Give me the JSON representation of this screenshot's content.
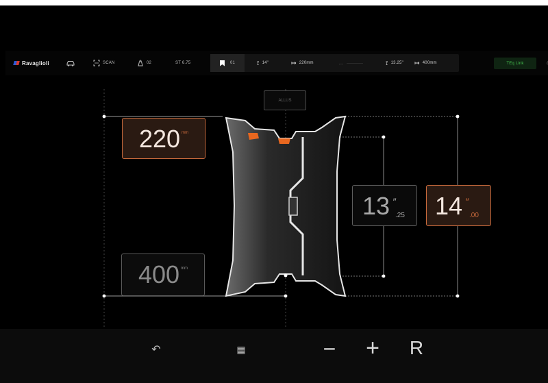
{
  "topbar": {
    "brand": "Ravaglioli",
    "scan_label": "SCAN",
    "station_label": "02",
    "st_label": "ST 6.75",
    "preset_label": "01",
    "rim_diameter": "14\"",
    "rim_width": "220mm",
    "alt_diameter": "13.25\"",
    "alt_width": "400mm",
    "link_label": "TEq Link"
  },
  "material": "ALLUS",
  "measure": {
    "offset_value": "220",
    "offset_unit": "mm",
    "distance_value": "400",
    "distance_unit": "mm",
    "alt_diam_int": "13",
    "alt_diam_dec": ".25",
    "diam_int": "14",
    "diam_dec": ".00",
    "inch_symbol": "″"
  },
  "bottombar": {
    "undo_glyph": "↶",
    "grid_glyph": "▦",
    "minus_glyph": "−",
    "plus_glyph": "+",
    "reset_label": "R"
  },
  "colors": {
    "accent": "#c96a3c",
    "wheel_insert": "#e8671f",
    "link_green": "#46c14f"
  },
  "icons": {
    "car": "car-icon",
    "scan": "scan-frame-icon",
    "weight": "weight-icon",
    "bookmark": "bookmark-icon",
    "vertical_dim": "vertical-dimension-icon",
    "horizontal_dim": "horizontal-dimension-icon",
    "home": "home-icon"
  }
}
